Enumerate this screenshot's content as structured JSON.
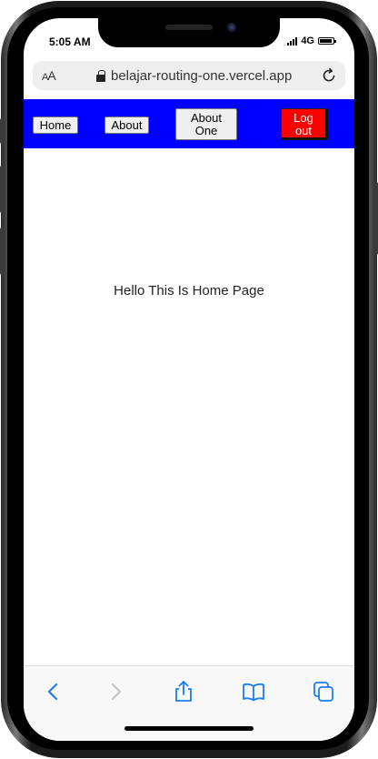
{
  "status_bar": {
    "time": "5:05 AM",
    "network": "4G",
    "battery_level": 0.9
  },
  "browser": {
    "text_size_label_small": "A",
    "text_size_label_large": "A",
    "url": "belajar-routing-one.vercel.app",
    "lock_icon": "lock-icon",
    "reload_icon": "reload-icon"
  },
  "navbar": {
    "background_color": "#0000ff",
    "home_label": "Home",
    "about_label": "About",
    "about_one_label": "About One",
    "logout_label": "Log out",
    "logout_color": "#ff0000"
  },
  "main": {
    "message": "Hello This Is Home Page"
  },
  "toolbar": {
    "accent_color": "#1a7ef5",
    "icons": [
      "back-icon",
      "forward-icon",
      "share-icon",
      "bookmarks-icon",
      "tabs-icon"
    ]
  }
}
